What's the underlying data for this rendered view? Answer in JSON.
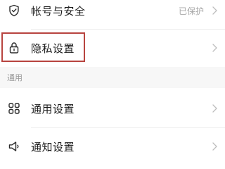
{
  "rows": {
    "account_security": {
      "label": "帐号与安全",
      "value": "已保护",
      "icon": "shield-check-icon"
    },
    "privacy": {
      "label": "隐私设置",
      "icon": "lock-icon"
    },
    "general": {
      "label": "通用设置",
      "icon": "grid-icon"
    },
    "notification": {
      "label": "通知设置",
      "icon": "speaker-icon"
    }
  },
  "sections": {
    "general_header": "通用"
  },
  "colors": {
    "highlight_border": "#b8443f",
    "section_bg": "#f7f7f7",
    "secondary_text": "#a8a8a8"
  }
}
